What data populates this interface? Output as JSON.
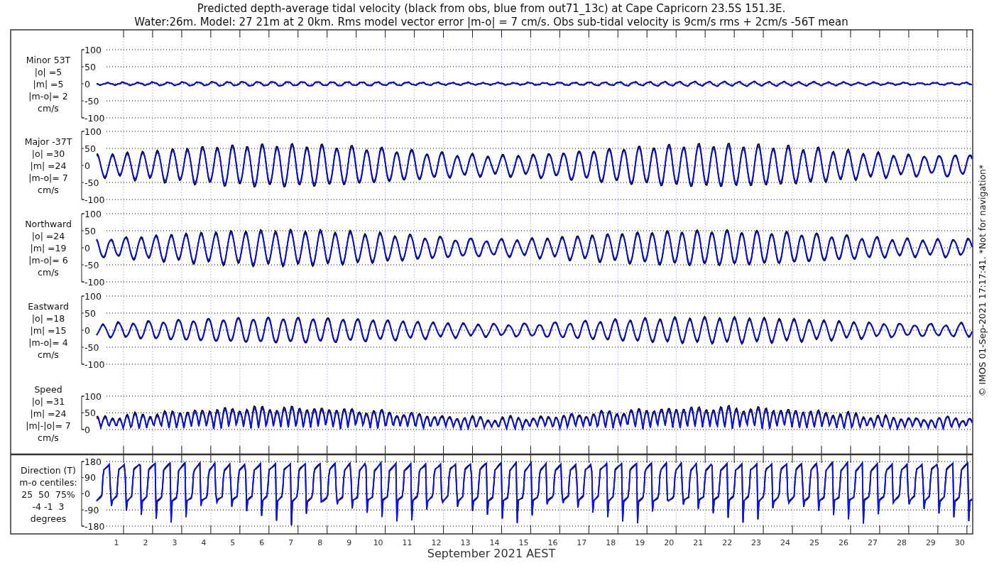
{
  "title": [
    "Predicted depth-average tidal velocity (black from obs, blue from out71_13c) at Cape Capricorn 23.5S 151.3E.",
    "Water:26m. Model: 27 21m at 2 0km. Rms model vector error |m-o| = 7 cm/s. Obs sub-tidal velocity is 9cm/s rms + 2cm/s -56T mean"
  ],
  "panels": [
    {
      "kind": "velocity",
      "labels": [
        "Minor 53T",
        "|o| =5",
        "|m| =5",
        "|m-o|= 2",
        "cm/s"
      ],
      "yticks": [
        "100",
        "50",
        "0",
        "-50",
        "-100"
      ]
    },
    {
      "kind": "velocity",
      "labels": [
        "Major -37T",
        "|o| =30",
        "|m| =24",
        "|m-o|= 7",
        "cm/s"
      ],
      "yticks": [
        "100",
        "50",
        "0",
        "-50",
        "-100"
      ]
    },
    {
      "kind": "velocity",
      "labels": [
        "Northward",
        "|o| =24",
        "|m| =19",
        "|m-o|= 6",
        "cm/s"
      ],
      "yticks": [
        "100",
        "50",
        "0",
        "-50",
        "-100"
      ]
    },
    {
      "kind": "velocity",
      "labels": [
        "Eastward",
        "|o| =18",
        "|m| =15",
        "|m-o|= 4",
        "cm/s"
      ],
      "yticks": [
        "100",
        "50",
        "0",
        "-50",
        "-100"
      ]
    },
    {
      "kind": "speed",
      "labels": [
        "Speed",
        "|o| =31",
        "|m| =24",
        "|m|-|o|= 7",
        "cm/s"
      ],
      "yticks": [
        "100",
        "50",
        "0"
      ]
    },
    {
      "kind": "direction",
      "labels": [
        "Direction (T)",
        "m-o centiles:",
        "25  50  75%",
        "-4 -1  3",
        "degrees"
      ],
      "yticks": [
        "180",
        "90",
        "0",
        "-90",
        "-180"
      ]
    }
  ],
  "x_axis": {
    "day_labels": [
      "1",
      "2",
      "3",
      "4",
      "5",
      "6",
      "7",
      "8",
      "9",
      "10",
      "11",
      "12",
      "13",
      "14",
      "15",
      "16",
      "17",
      "18",
      "19",
      "20",
      "21",
      "22",
      "23",
      "24",
      "25",
      "26",
      "27",
      "28",
      "29",
      "30"
    ],
    "label": "September 2021 AEST"
  },
  "footer": "© IMOS 01-Sep-2021 17:17:41. *Not for navigation*"
}
